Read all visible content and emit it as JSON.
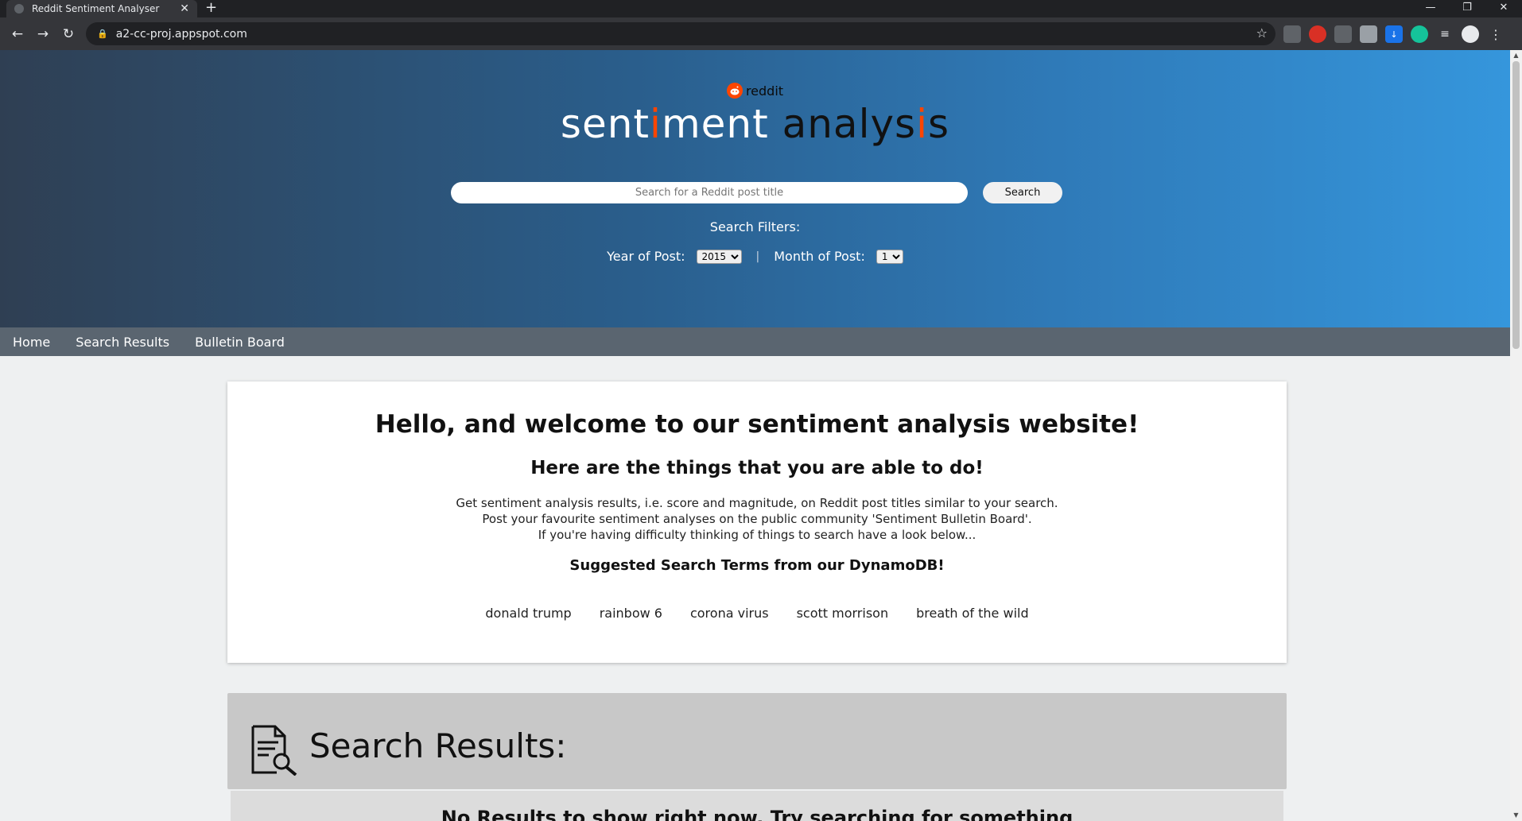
{
  "browser": {
    "tab_title": "Reddit Sentiment Analyser",
    "tab_close": "✕",
    "new_tab": "+",
    "url": "a2-cc-proj.appspot.com",
    "window_controls": {
      "minimize": "—",
      "restore": "❐",
      "close": "✕"
    }
  },
  "header": {
    "reddit_wordmark": "reddit",
    "title_parts": [
      {
        "text": "sent",
        "tone": "white"
      },
      {
        "text": "i",
        "tone": "orange"
      },
      {
        "text": "ment ",
        "tone": "white"
      },
      {
        "text": "analys",
        "tone": "dark"
      },
      {
        "text": "i",
        "tone": "orange"
      },
      {
        "text": "s",
        "tone": "dark"
      }
    ],
    "search_placeholder": "Search for a Reddit post title",
    "search_button": "Search",
    "filters_label": "Search Filters:",
    "year_label": "Year of Post:",
    "year_value": "2015",
    "month_label": "Month of Post:",
    "month_value": "1",
    "separator": "|"
  },
  "nav": {
    "items": [
      "Home",
      "Search Results",
      "Bulletin Board"
    ]
  },
  "welcome": {
    "heading": "Hello, and welcome to our sentiment analysis website!",
    "subheading": "Here are the things that you are able to do!",
    "lines": [
      "Get sentiment analysis results, i.e. score and magnitude, on Reddit post titles similar to your search.",
      "Post your favourite sentiment analyses on the public community 'Sentiment Bulletin Board'.",
      "If you're having difficulty thinking of things to search have a look below..."
    ],
    "suggested_heading": "Suggested Search Terms from our DynamoDB!",
    "suggested_terms": [
      "donald trump",
      "rainbow 6",
      "corona virus",
      "scott morrison",
      "breath of the wild"
    ]
  },
  "results": {
    "title": "Search Results:",
    "empty_message": "No Results to show right now. Try searching for something"
  },
  "colors": {
    "orange": "#ff4500",
    "nav_bg": "#5a6570"
  }
}
